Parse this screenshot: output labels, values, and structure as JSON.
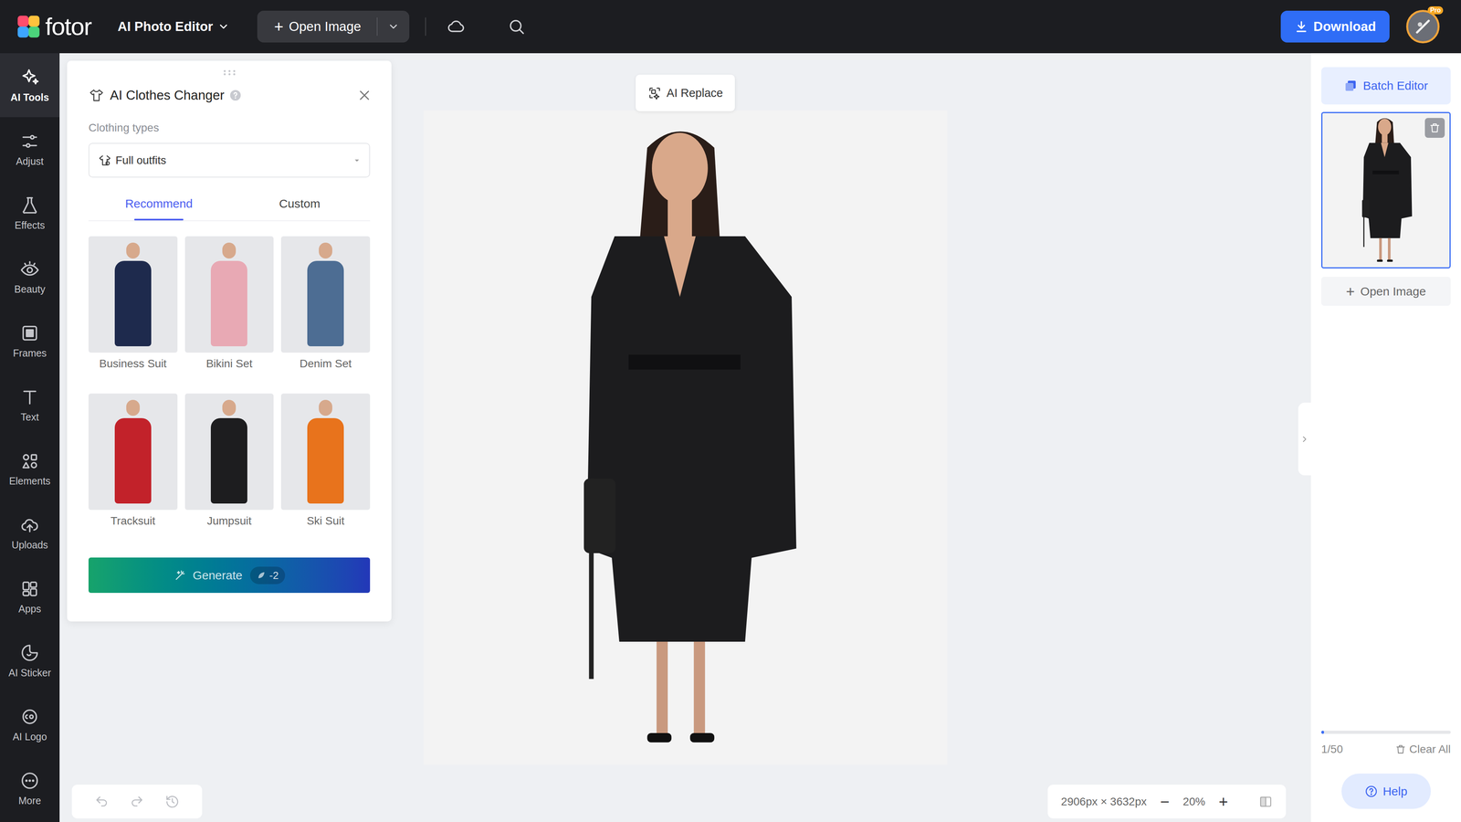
{
  "topbar": {
    "logo": "fotor",
    "mode_menu": "AI Photo Editor",
    "open_image_plus": "+",
    "open_image": "Open Image",
    "download": "Download",
    "avatar_badge": "Pro"
  },
  "sidebar": {
    "items": [
      {
        "label": "AI Tools",
        "selected": true
      },
      {
        "label": "Adjust",
        "selected": false
      },
      {
        "label": "Effects",
        "selected": false
      },
      {
        "label": "Beauty",
        "selected": false
      },
      {
        "label": "Frames",
        "selected": false
      },
      {
        "label": "Text",
        "selected": false
      },
      {
        "label": "Elements",
        "selected": false
      },
      {
        "label": "Uploads",
        "selected": false
      },
      {
        "label": "Apps",
        "selected": false
      },
      {
        "label": "AI Sticker",
        "selected": false
      },
      {
        "label": "AI Logo",
        "selected": false
      },
      {
        "label": "More",
        "selected": false
      }
    ]
  },
  "panel": {
    "title": "AI Clothes Changer",
    "clothing_types_label": "Clothing types",
    "clothing_type": "Full outfits",
    "tabs": [
      {
        "label": "Recommend",
        "selected": true
      },
      {
        "label": "Custom",
        "selected": false
      }
    ],
    "outfits": [
      {
        "label": "Business Suit",
        "color": "#1e2a4d"
      },
      {
        "label": "Bikini Set",
        "color": "#e8a9b4"
      },
      {
        "label": "Denim Set",
        "color": "#4d6d93"
      },
      {
        "label": "Tracksuit",
        "color": "#c2222a"
      },
      {
        "label": "Jumpsuit",
        "color": "#1d1d1f"
      },
      {
        "label": "Ski Suit",
        "color": "#e8731c"
      }
    ],
    "generate": {
      "label": "Generate",
      "cost": "-2"
    }
  },
  "canvas": {
    "ai_replace": "AI Replace",
    "dimensions": "2906px × 3632px",
    "zoom_out": "−",
    "zoom": "20%",
    "zoom_in": "+"
  },
  "right_panel": {
    "batch_editor": "Batch Editor",
    "thumbnails": [
      {
        "selected": true
      }
    ],
    "open_image_plus": "+",
    "open_image": "Open Image",
    "quota": {
      "level": 0.02,
      "reading": "1/50"
    },
    "clear_all": "Clear All",
    "help": "Help"
  }
}
